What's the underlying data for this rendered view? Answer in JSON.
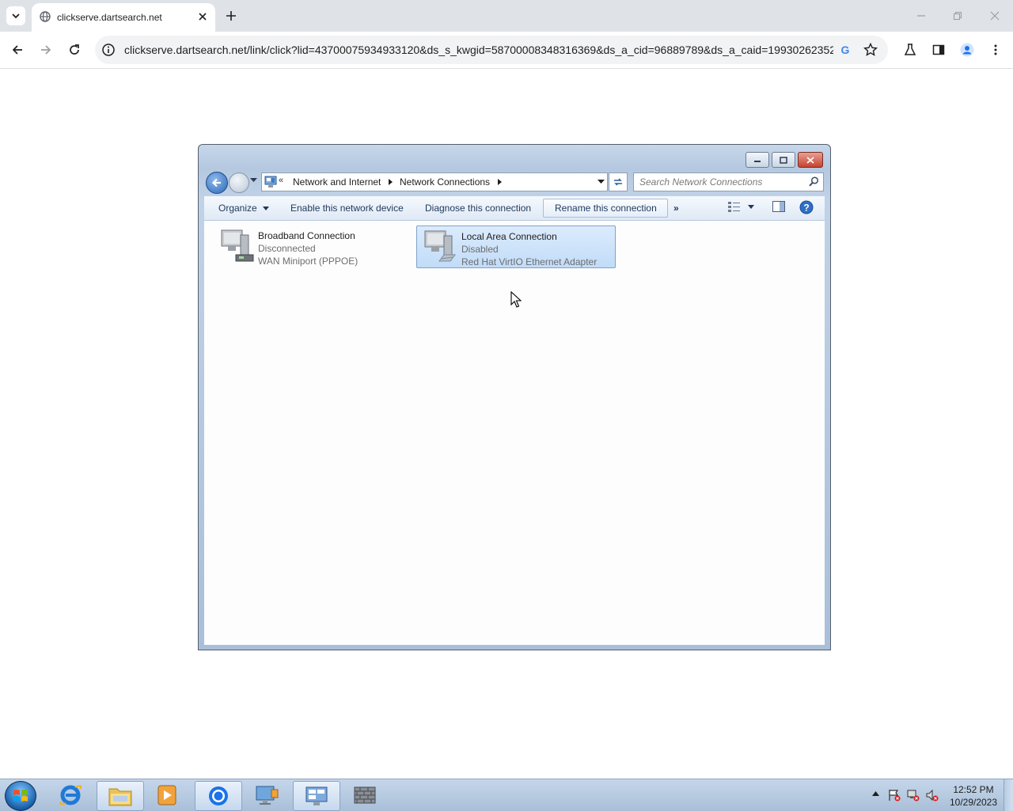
{
  "browser": {
    "tab_title": "clickserve.dartsearch.net",
    "url": "clickserve.dartsearch.net/link/click?lid=43700075934933120&ds_s_kwgid=58700008348316369&ds_a_cid=96889789&ds_a_caid=19930262352..."
  },
  "explorer": {
    "breadcrumb": [
      "Network and Internet",
      "Network Connections"
    ],
    "search_placeholder": "Search Network Connections",
    "commands": {
      "organize": "Organize",
      "enable": "Enable this network device",
      "diagnose": "Diagnose this connection",
      "rename": "Rename this connection",
      "more": "»"
    },
    "connections": [
      {
        "name": "Broadband Connection",
        "status": "Disconnected",
        "device": "WAN Miniport (PPPOE)",
        "selected": false
      },
      {
        "name": "Local Area Connection",
        "status": "Disabled",
        "device": "Red Hat VirtIO Ethernet Adapter",
        "selected": true
      }
    ]
  },
  "taskbar": {
    "time": "12:52 PM",
    "date": "10/29/2023"
  },
  "colors": {
    "selection": "#c1dcf8",
    "command_text": "#1e395b",
    "taskbar": "#b4c8e0"
  }
}
